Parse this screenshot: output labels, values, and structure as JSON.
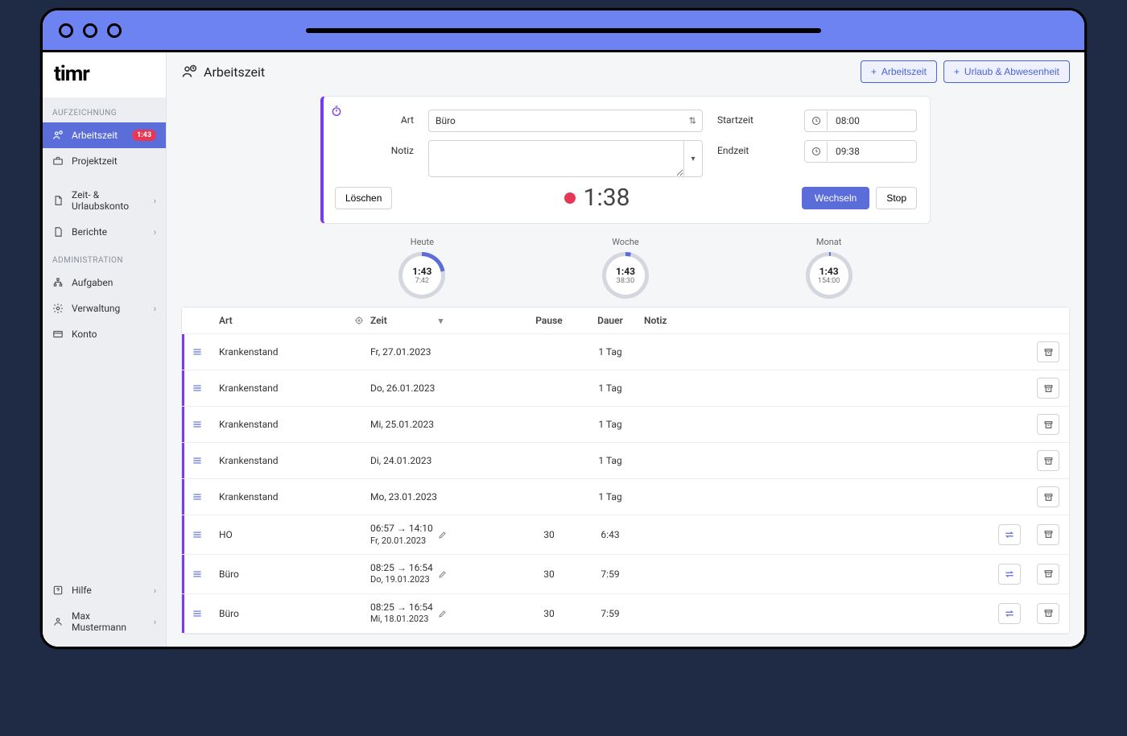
{
  "logo": "timr",
  "sidebar": {
    "section_recording": "AUFZEICHNUNG",
    "items_recording": [
      {
        "label": "Arbeitszeit",
        "badge": "1:43",
        "active": true
      },
      {
        "label": "Projektzeit"
      }
    ],
    "items_reports": [
      {
        "label": "Zeit- & Urlaubskonto",
        "chev": true
      },
      {
        "label": "Berichte",
        "chev": true
      }
    ],
    "section_admin": "ADMINISTRATION",
    "items_admin": [
      {
        "label": "Aufgaben"
      },
      {
        "label": "Verwaltung",
        "chev": true
      },
      {
        "label": "Konto"
      }
    ],
    "footer": [
      {
        "label": "Hilfe",
        "chev": true
      },
      {
        "label": "Max Mustermann",
        "chev": true
      }
    ]
  },
  "page_title": "Arbeitszeit",
  "actions": {
    "add_worktime": "Arbeitszeit",
    "add_absence": "Urlaub & Abwesenheit"
  },
  "timer": {
    "type_label": "Art",
    "type_value": "Büro",
    "note_label": "Notiz",
    "note_value": "",
    "start_label": "Startzeit",
    "start_value": "08:00",
    "end_label": "Endzeit",
    "end_value": "09:38",
    "delete_btn": "Löschen",
    "elapsed": "1:38",
    "switch_btn": "Wechseln",
    "stop_btn": "Stop"
  },
  "gauges": [
    {
      "label": "Heute",
      "main": "1:43",
      "sub": "7:42",
      "pct": 22
    },
    {
      "label": "Woche",
      "main": "1:43",
      "sub": "38:30",
      "pct": 4
    },
    {
      "label": "Monat",
      "main": "1:43",
      "sub": "154:00",
      "pct": 1
    }
  ],
  "table": {
    "cols": {
      "art": "Art",
      "zeit": "Zeit",
      "pause": "Pause",
      "dauer": "Dauer",
      "notiz": "Notiz"
    },
    "rows": [
      {
        "art": "Krankenstand",
        "zeit_date": "Fr, 27.01.2023",
        "dauer": "1 Tag"
      },
      {
        "art": "Krankenstand",
        "zeit_date": "Do, 26.01.2023",
        "dauer": "1 Tag"
      },
      {
        "art": "Krankenstand",
        "zeit_date": "Mi, 25.01.2023",
        "dauer": "1 Tag"
      },
      {
        "art": "Krankenstand",
        "zeit_date": "Di, 24.01.2023",
        "dauer": "1 Tag"
      },
      {
        "art": "Krankenstand",
        "zeit_date": "Mo, 23.01.2023",
        "dauer": "1 Tag"
      },
      {
        "art": "HO",
        "zeit_main": "06:57 → 14:10",
        "zeit_date": "Fr, 20.01.2023",
        "pause": "30",
        "dauer": "6:43",
        "editable": true
      },
      {
        "art": "Büro",
        "zeit_main": "08:25 → 16:54",
        "zeit_date": "Do, 19.01.2023",
        "pause": "30",
        "dauer": "7:59",
        "editable": true
      },
      {
        "art": "Büro",
        "zeit_main": "08:25 → 16:54",
        "zeit_date": "Mi, 18.01.2023",
        "pause": "30",
        "dauer": "7:59",
        "editable": true
      }
    ]
  }
}
